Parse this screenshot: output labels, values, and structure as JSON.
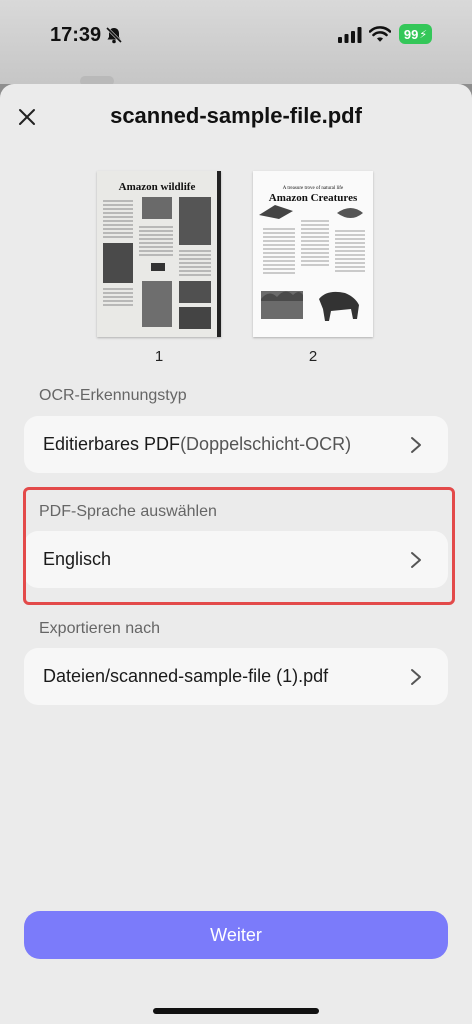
{
  "status_bar": {
    "time": "17:39",
    "battery": "99"
  },
  "header": {
    "title": "scanned-sample-file.pdf"
  },
  "pages": [
    {
      "number": "1",
      "heading": "Amazon wildlife"
    },
    {
      "number": "2",
      "kicker": "A treasure trove of natural life",
      "heading": "Amazon Creatures"
    }
  ],
  "ocr_type": {
    "label": "OCR-Erkennungstyp",
    "value": "Editierbares PDF",
    "value_suffix": "(Doppelschicht-OCR)"
  },
  "language": {
    "label": "PDF-Sprache auswählen",
    "value": "Englisch"
  },
  "export": {
    "label": "Exportieren nach",
    "value": "Dateien/scanned-sample-file (1).pdf"
  },
  "primary_button": {
    "label": "Weiter"
  },
  "colors": {
    "accent": "#7b7bfa",
    "highlight": "#e34a4a",
    "battery": "#34c759"
  }
}
